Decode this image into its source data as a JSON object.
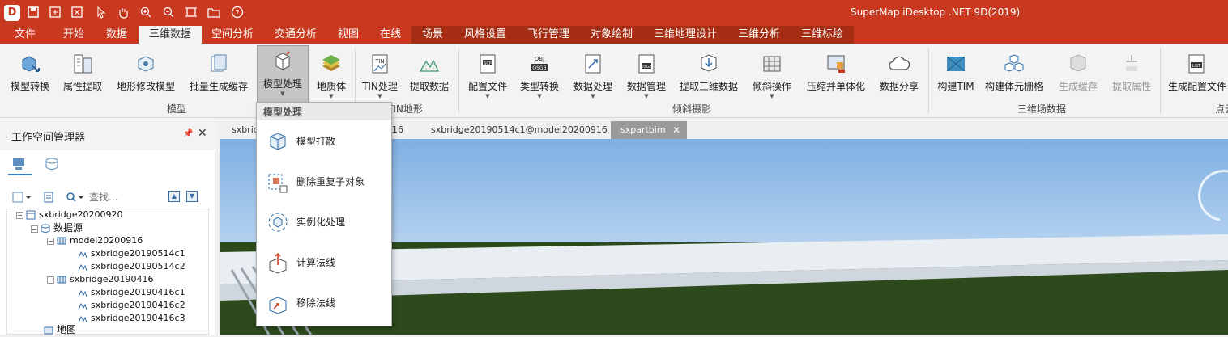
{
  "window": {
    "title": "SuperMap iDesktop .NET 9D(2019)"
  },
  "quick_access": {
    "logo": "D",
    "icons": [
      "save-icon",
      "new-window-icon",
      "close-window-icon",
      "pointer-icon",
      "pan-hand-icon",
      "zoom-in-icon",
      "zoom-out-icon",
      "full-extent-icon",
      "open-folder-icon",
      "help-icon"
    ]
  },
  "tabs": [
    {
      "label": "文件"
    },
    {
      "label": "开始"
    },
    {
      "label": "数据"
    },
    {
      "label": "三维数据",
      "active": true
    },
    {
      "label": "空间分析"
    },
    {
      "label": "交通分析"
    },
    {
      "label": "视图"
    },
    {
      "label": "在线"
    },
    {
      "label": "场景"
    },
    {
      "label": "风格设置"
    },
    {
      "label": "飞行管理"
    },
    {
      "label": "对象绘制"
    },
    {
      "label": "三维地理设计"
    },
    {
      "label": "三维分析"
    },
    {
      "label": "三维标绘"
    }
  ],
  "ribbon": {
    "buttons": [
      {
        "label": "模型转换"
      },
      {
        "label": "属性提取"
      },
      {
        "label": "地形修改模型"
      },
      {
        "label": "批量生成缓存"
      },
      {
        "label": "模型处理",
        "selected": true,
        "dropdown": true
      },
      {
        "label": "地质体",
        "dropdown": true
      },
      {
        "label": "TIN处理",
        "dropdown": true
      },
      {
        "label": "提取数据"
      },
      {
        "label": "配置文件",
        "dropdown": true
      },
      {
        "label": "类型转换",
        "dropdown": true
      },
      {
        "label": "数据处理",
        "dropdown": true
      },
      {
        "label": "数据管理",
        "dropdown": true
      },
      {
        "label": "提取三维数据"
      },
      {
        "label": "倾斜操作",
        "dropdown": true
      },
      {
        "label": "压缩并单体化"
      },
      {
        "label": "数据分享"
      },
      {
        "label": "构建TIM"
      },
      {
        "label": "构建体元栅格"
      },
      {
        "label": "生成缓存",
        "disabled": true
      },
      {
        "label": "提取属性",
        "disabled": true
      },
      {
        "label": "生成配置文件"
      }
    ],
    "icon_text": {
      "tin": "TIN",
      "scp": "SCP",
      "obj": "OBJ",
      "osgb": "OSGB",
      "osgb2": "OSGB",
      "list": "LIST"
    },
    "groups": [
      {
        "label": "模型"
      },
      {
        "label": "TIN地形"
      },
      {
        "label": "倾斜摄影"
      },
      {
        "label": "三维场数据"
      },
      {
        "label": "点云"
      }
    ]
  },
  "dropdown": {
    "title": "模型处理",
    "items": [
      {
        "label": "模型打散"
      },
      {
        "label": "删除重复子对象"
      },
      {
        "label": "实例化处理"
      },
      {
        "label": "计算法线"
      },
      {
        "label": "移除法线"
      }
    ]
  },
  "workspace": {
    "title": "工作空间管理器",
    "search_placeholder": "查找...",
    "tree": [
      {
        "label": "sxbridge20200920"
      },
      {
        "label": "数据源"
      },
      {
        "label": "model20200916"
      },
      {
        "label": "sxbridge20190514c1"
      },
      {
        "label": "sxbridge20190514c2"
      },
      {
        "label": "sxbridge20190416"
      },
      {
        "label": "sxbridge20190416c1"
      },
      {
        "label": "sxbridge20190416c2"
      },
      {
        "label": "sxbridge20190416c3"
      },
      {
        "label": "地图"
      }
    ]
  },
  "doc_tabs": [
    {
      "label": "sxbridge"
    },
    {
      "label": "16"
    },
    {
      "label": "sxbridge20190514c1@model20200916"
    },
    {
      "label": "sxpartbim",
      "active": true
    }
  ],
  "colors": {
    "accent": "#c9391f",
    "context_tab": "#a52d14",
    "sky": "#a9cbee",
    "grass": "#2d4a1c"
  }
}
